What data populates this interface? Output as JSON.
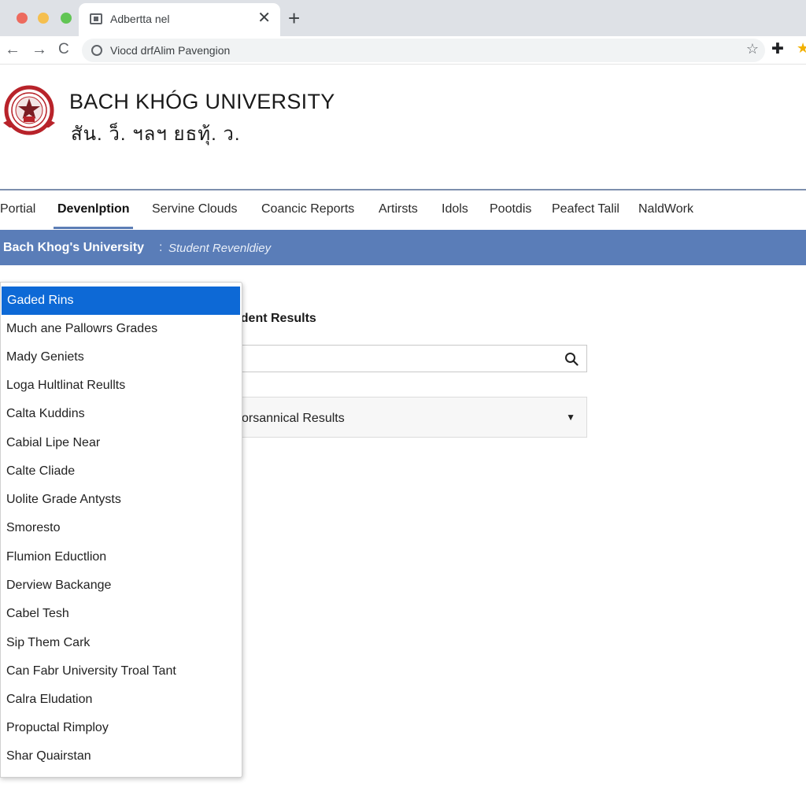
{
  "browser": {
    "tab_title": "Adbertta nel",
    "tab_close": "✕",
    "new_tab": "+",
    "address": "Viocd drfAlim Pavengion",
    "nav_back": "←",
    "nav_forward": "→",
    "nav_reload": "C",
    "bookmark_star": "☆",
    "ext_pin": "✚",
    "ext_star": "★"
  },
  "site": {
    "name": "BACH KHÓG UNIVERSITY",
    "subtitle": "สัน. ว็. ฯลฯ ยธทุ้. ว."
  },
  "main_nav": {
    "items": [
      {
        "label": "Portial"
      },
      {
        "label": "Devenlption",
        "active": true
      },
      {
        "label": "Servine Clouds"
      },
      {
        "label": "Coancic Reports"
      },
      {
        "label": "Artirsts"
      },
      {
        "label": "Idols"
      },
      {
        "label": "Pootdis"
      },
      {
        "label": "Peafect Talil"
      },
      {
        "label": "NaldWork"
      }
    ]
  },
  "breadcrumb": {
    "title": "Bach Khog's University",
    "separator": ":",
    "subtitle": "Student Revenldiey"
  },
  "content": {
    "heading": "udent Results",
    "search_value": "",
    "select_value": "orsannical Results",
    "select_caret": "▼"
  },
  "dropdown": {
    "selected_index": 0,
    "items": [
      "Gaded Rins",
      "Much ane Pallowrs Grades",
      "Mady Geniets",
      "Loga Hultlinat Reullts",
      "Calta Kuddins",
      "Cabial Lipe Near",
      "Calte Cliade",
      "Uolite Grade Antysts",
      "Smoresto",
      "Flumion Eductlion",
      "Derview Backange",
      "Cabel Tesh",
      "Sip Them Cark",
      "Can Fabr University Troal Tant",
      "Calra Eludation",
      "Propuctal Rimploy",
      "Shar Quairstan"
    ]
  },
  "colors": {
    "accent_blue": "#5a7db8",
    "selected_item": "#0d69d6",
    "logo_red": "#b8232a"
  }
}
